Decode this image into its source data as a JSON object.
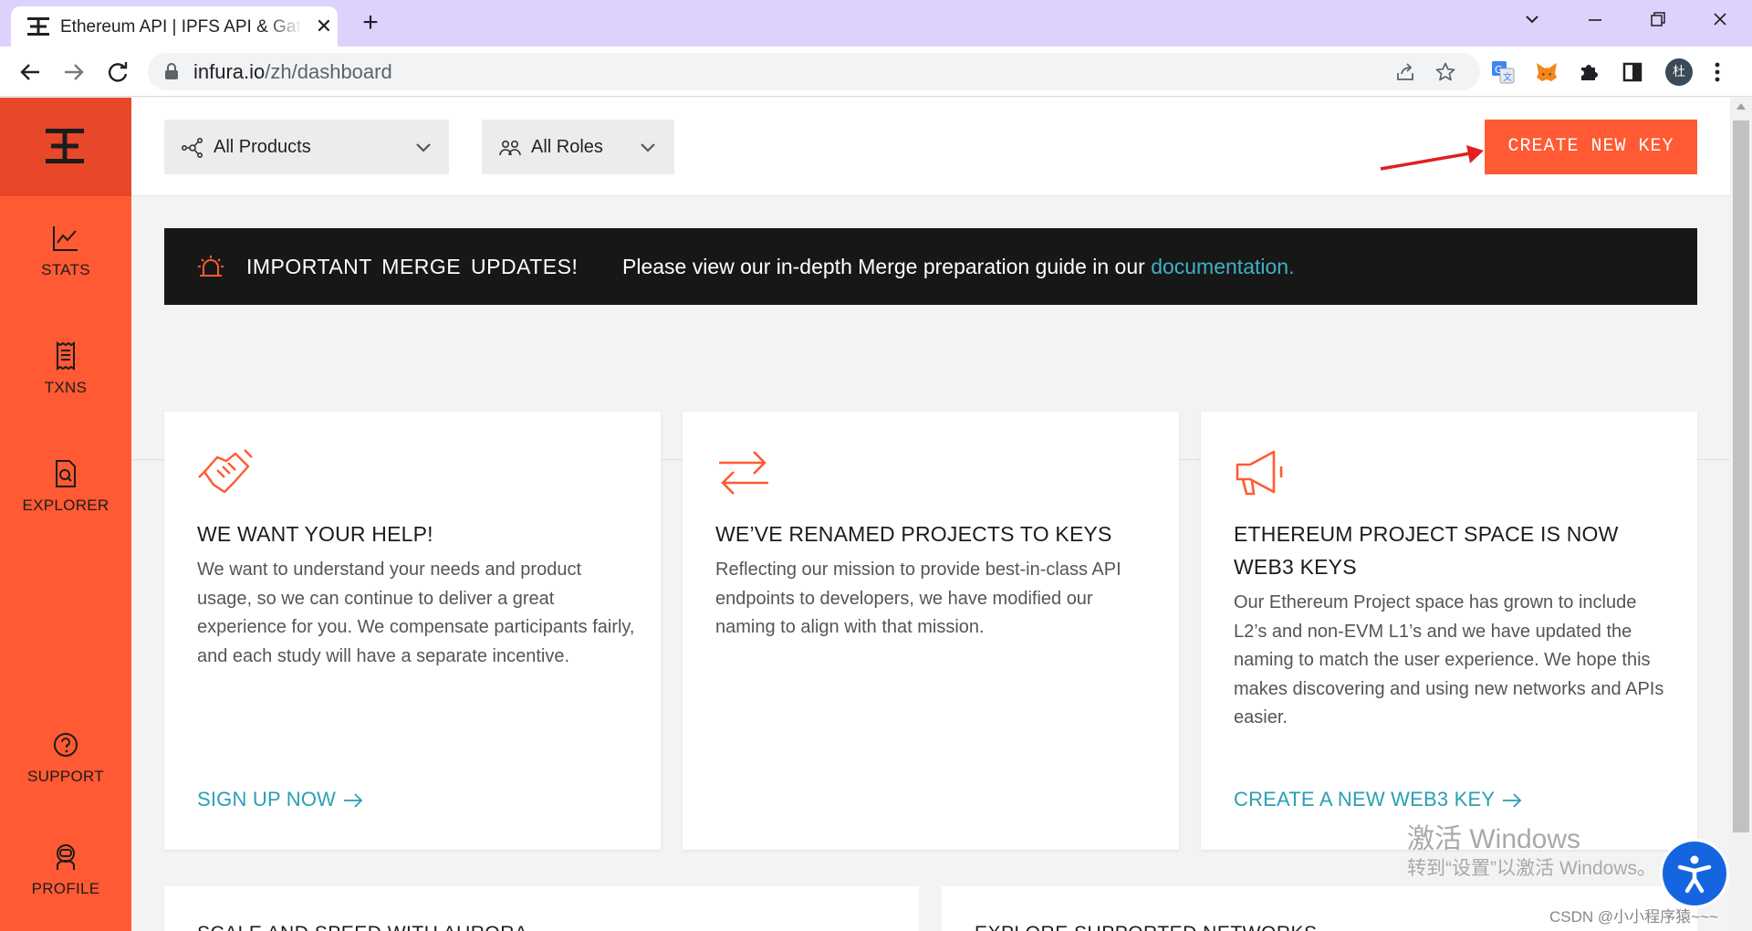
{
  "browser": {
    "tab_title": "Ethereum API | IPFS API & Gateway",
    "tab_close": "✕",
    "new_tab": "+",
    "url_host": "infura.io",
    "url_path": "/zh/dashboard",
    "avatar_initial": "杜"
  },
  "sidebar": {
    "items": [
      {
        "label": "STATS",
        "icon": "line-chart-icon"
      },
      {
        "label": "TXNS",
        "icon": "receipt-icon"
      },
      {
        "label": "EXPLORER",
        "icon": "document-search-icon"
      },
      {
        "label": "SUPPORT",
        "icon": "question-circle-icon"
      },
      {
        "label": "PROFILE",
        "icon": "astronaut-icon"
      }
    ]
  },
  "topbar": {
    "products_label": "All Products",
    "roles_label": "All Roles",
    "create_key_label": "CREATE NEW KEY"
  },
  "banner": {
    "title": "IMPORTANT MERGE UPDATES!",
    "message": "Please view our in-depth Merge preparation guide in our ",
    "link": "documentation."
  },
  "cards": [
    {
      "title": "WE WANT YOUR HELP!",
      "body": "We want to understand your needs and product usage, so we can continue to deliver a great experience for you. We compensate participants fairly, and each study will have a separate incentive.",
      "cta": "SIGN UP NOW"
    },
    {
      "title": "WE’VE RENAMED PROJECTS TO KEYS",
      "body": "Reflecting our mission to provide best-in-class API endpoints to developers, we have modified our naming to align with that mission.",
      "cta": ""
    },
    {
      "title": "ETHEREUM PROJECT SPACE IS NOW WEB3 KEYS",
      "body": "Our Ethereum Project space has grown to include L2’s and non-EVM L1’s and we have updated the naming to match the user experience. We hope this makes discovering and using new networks and APIs easier.",
      "cta": "CREATE A NEW WEB3 KEY"
    }
  ],
  "lower_cards": [
    {
      "title": "SCALE AND SPEED WITH AURORA"
    },
    {
      "title": "EXPLORE SUPPORTED NETWORKS"
    }
  ],
  "watermark": {
    "line1": "激活 Windows",
    "line2": "转到“设置”以激活 Windows。"
  },
  "credit": "CSDN @小小程序猿~~~",
  "colors": {
    "brand": "#ff5a33",
    "brand_dark": "#e8472a",
    "link": "#2a9fb3",
    "banner_bg": "#171717"
  }
}
